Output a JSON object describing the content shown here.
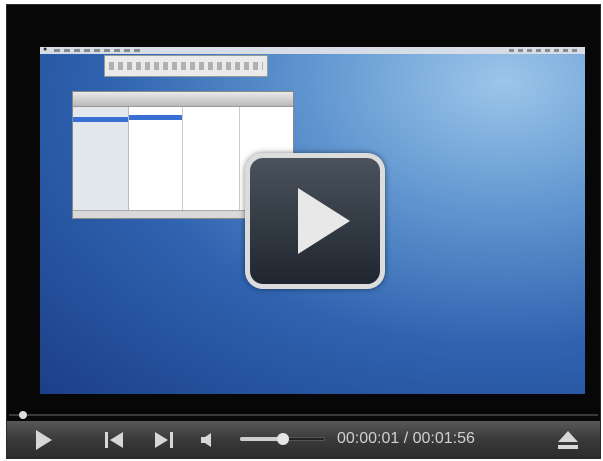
{
  "player": {
    "time_text": "00:00:01 / 00:01:56",
    "progress_fraction": 0.02,
    "volume_fraction": 0.5
  },
  "icons": {
    "big_play": "play-icon",
    "play": "play-icon",
    "previous": "skip-back-icon",
    "next": "skip-forward-icon",
    "volume": "speaker-icon",
    "eject": "eject-icon"
  },
  "colors": {
    "control_bar": "#3a3a3a",
    "icon": "#d7d7d7",
    "desktop_blue": "#2f63b0"
  }
}
